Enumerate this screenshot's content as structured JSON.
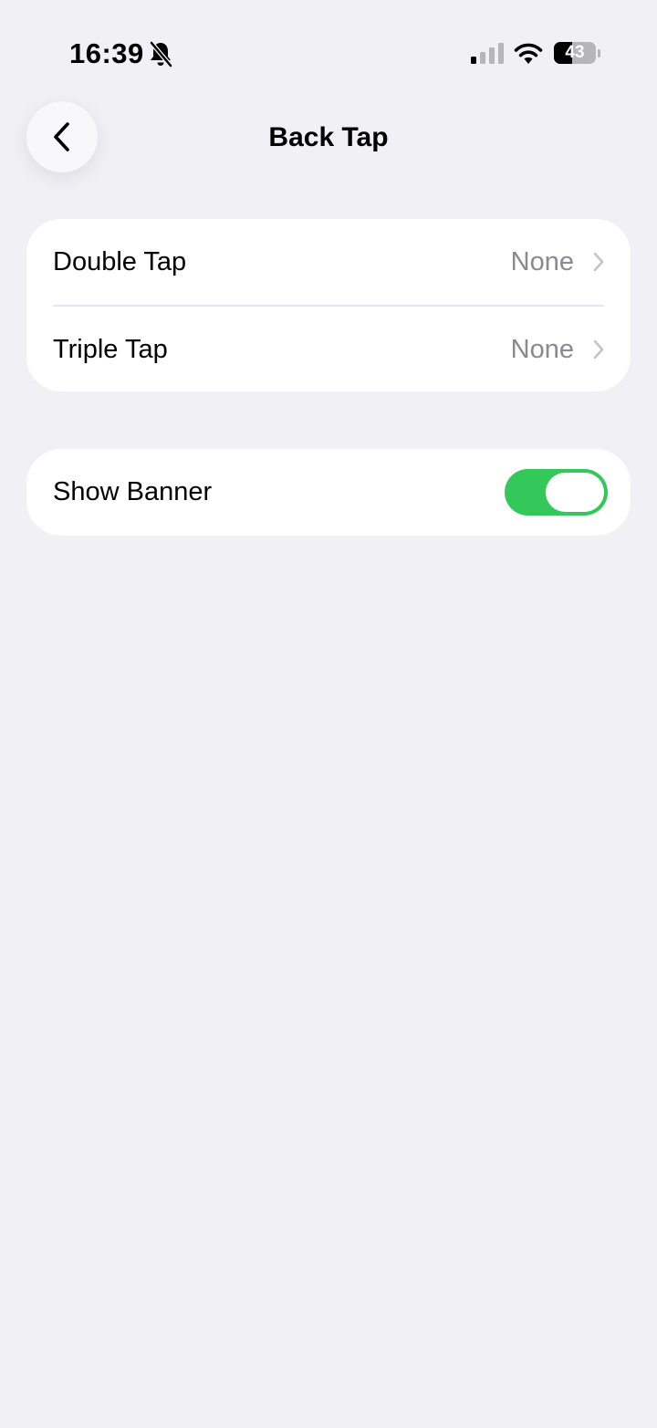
{
  "status_bar": {
    "time": "16:39",
    "battery_level": "43",
    "silent_mode_icon": "bell-slash-icon",
    "signal_icon": "cellular-signal-icon",
    "wifi_icon": "wifi-icon"
  },
  "nav": {
    "title": "Back Tap",
    "back_icon": "chevron-left-icon"
  },
  "tap_actions": [
    {
      "label": "Double Tap",
      "value": "None"
    },
    {
      "label": "Triple Tap",
      "value": "None"
    }
  ],
  "banner": {
    "label": "Show Banner",
    "enabled": true
  },
  "colors": {
    "background": "#f0f0f5",
    "card": "#ffffff",
    "toggle_on": "#34c759",
    "secondary_text": "#8a8a8e",
    "chevron": "#c4c4c7"
  }
}
